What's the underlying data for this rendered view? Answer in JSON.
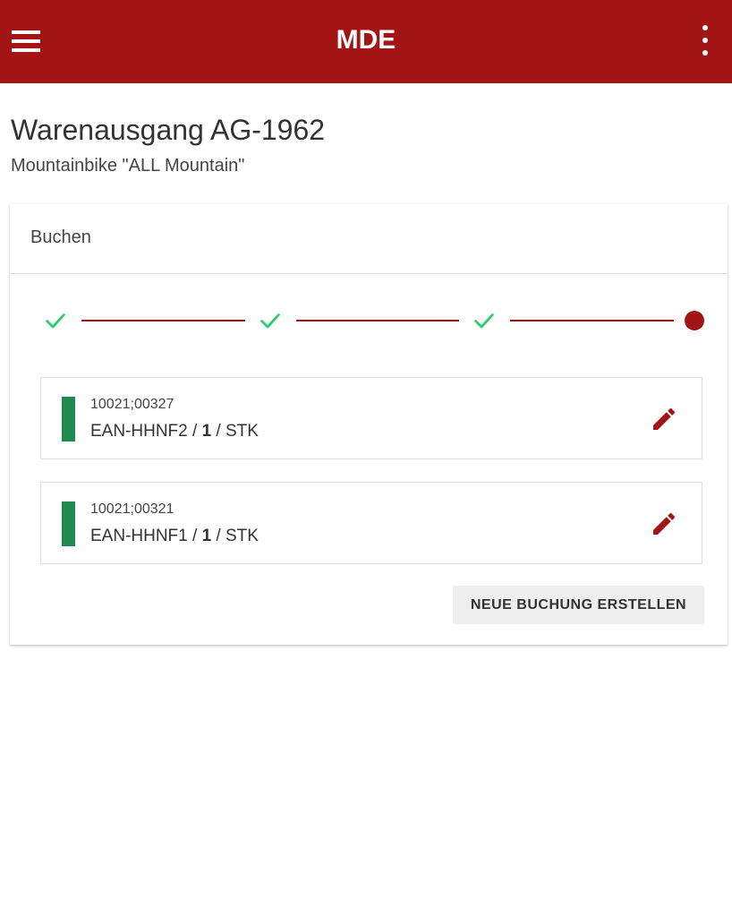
{
  "appbar": {
    "title": "MDE",
    "menu_icon": "menu-icon",
    "more_icon": "more-vertical-icon",
    "color": "#a31515"
  },
  "page": {
    "title": "Warenausgang AG-1962",
    "subtitle": "Mountainbike \"ALL Mountain\""
  },
  "card": {
    "header_label": "Buchen",
    "stepper": {
      "steps": [
        {
          "state": "done",
          "icon": "check-icon"
        },
        {
          "state": "done",
          "icon": "check-icon"
        },
        {
          "state": "done",
          "icon": "check-icon"
        },
        {
          "state": "current",
          "icon": "dot-icon"
        }
      ],
      "done_color": "#2ecc71",
      "active_color": "#a31515"
    },
    "items": [
      {
        "code": "10021;00327",
        "ean": "EAN-HHNF2",
        "sep1": " / ",
        "quantity": "1",
        "sep2": " / ",
        "unit": "STK",
        "status_color": "#1f8a4f",
        "edit_icon": "pencil-icon"
      },
      {
        "code": "10021;00321",
        "ean": "EAN-HHNF1",
        "sep1": " / ",
        "quantity": "1",
        "sep2": " / ",
        "unit": "STK",
        "status_color": "#1f8a4f",
        "edit_icon": "pencil-icon"
      }
    ],
    "new_booking_label": "NEUE BUCHUNG ERSTELLEN"
  }
}
